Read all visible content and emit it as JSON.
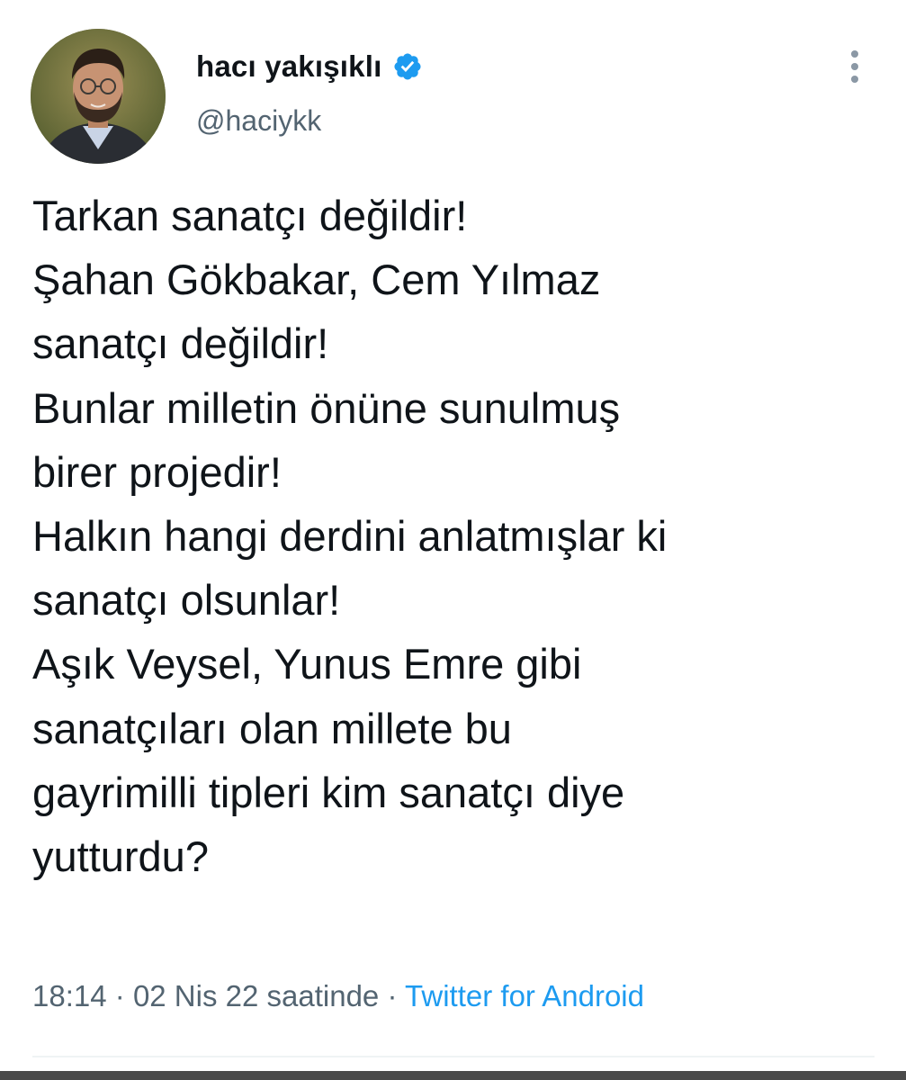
{
  "author": {
    "display_name": "hacı yakışıklı",
    "handle": "@haciykk",
    "verified": true,
    "avatar": "profile-photo"
  },
  "tweet": {
    "lines": [
      "Tarkan sanatçı değildir!",
      "Şahan Gökbakar, Cem Yılmaz",
      "sanatçı değildir!",
      "Bunlar milletin önüne sunulmuş",
      "birer projedir!",
      "Halkın hangi derdini anlatmışlar ki",
      "sanatçı olsunlar!",
      "Aşık Veysel, Yunus Emre gibi",
      "sanatçıları olan millete bu",
      "gayrimilli tipleri kim sanatçı diye",
      "yutturdu?"
    ]
  },
  "meta": {
    "time": "18:14",
    "separator": "·",
    "date": "02 Nis 22 saatinde",
    "source": "Twitter for Android"
  },
  "icons": {
    "verified": "verified-badge-icon",
    "more": "more-vertical-icon"
  },
  "colors": {
    "text": "#0f1419",
    "secondary": "#536471",
    "accent": "#1d9bf0",
    "divider": "#eff3f4"
  }
}
